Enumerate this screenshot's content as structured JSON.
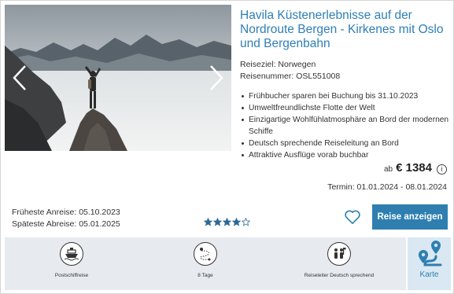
{
  "tour": {
    "title": "Havila Küstenerlebnisse auf der Nordroute Bergen - Kirkenes mit Oslo und Bergenbahn",
    "destination": "Reiseziel: Norwegen",
    "tour_number": "Reisenummer: OSL551008",
    "features": [
      "Frühbucher sparen bei Buchung bis 31.10.2023",
      "Umweltfreundlichste Flotte der Welt",
      "Einzigartige Wohlfühlatmosphäre an Bord der modernen Schiffe",
      "Deutsch sprechende Reiseleitung an Bord",
      "Attraktive Ausflüge vorab buchbar"
    ]
  },
  "price": {
    "prefix": "ab",
    "amount": "€ 1384",
    "info_icon_glyph": "i"
  },
  "termin": "Termin: 01.01.2024 - 08.01.2024",
  "dates": {
    "earliest": "Früheste Anreise: 05.10.2023",
    "latest": "Späteste Abreise: 05.01.2025"
  },
  "rating": {
    "value": 4,
    "max": 5
  },
  "actions": {
    "cta_label": "Reise anzeigen"
  },
  "footer": {
    "items": [
      {
        "label": "Postschiffreise",
        "icon": "ship-icon"
      },
      {
        "label": "8 Tage",
        "icon": "route-icon"
      },
      {
        "label": "Reiseleiter Deutsch sprechend",
        "icon": "guide-icon"
      }
    ],
    "map_label": "Karte",
    "map_icon": "map-pin-icon"
  },
  "colors": {
    "accent": "#2e7fb0",
    "title": "#2f7fb5",
    "footer_bg": "#e7ebef",
    "map_bg": "#d9e8f2",
    "star": "#2e6a99"
  }
}
